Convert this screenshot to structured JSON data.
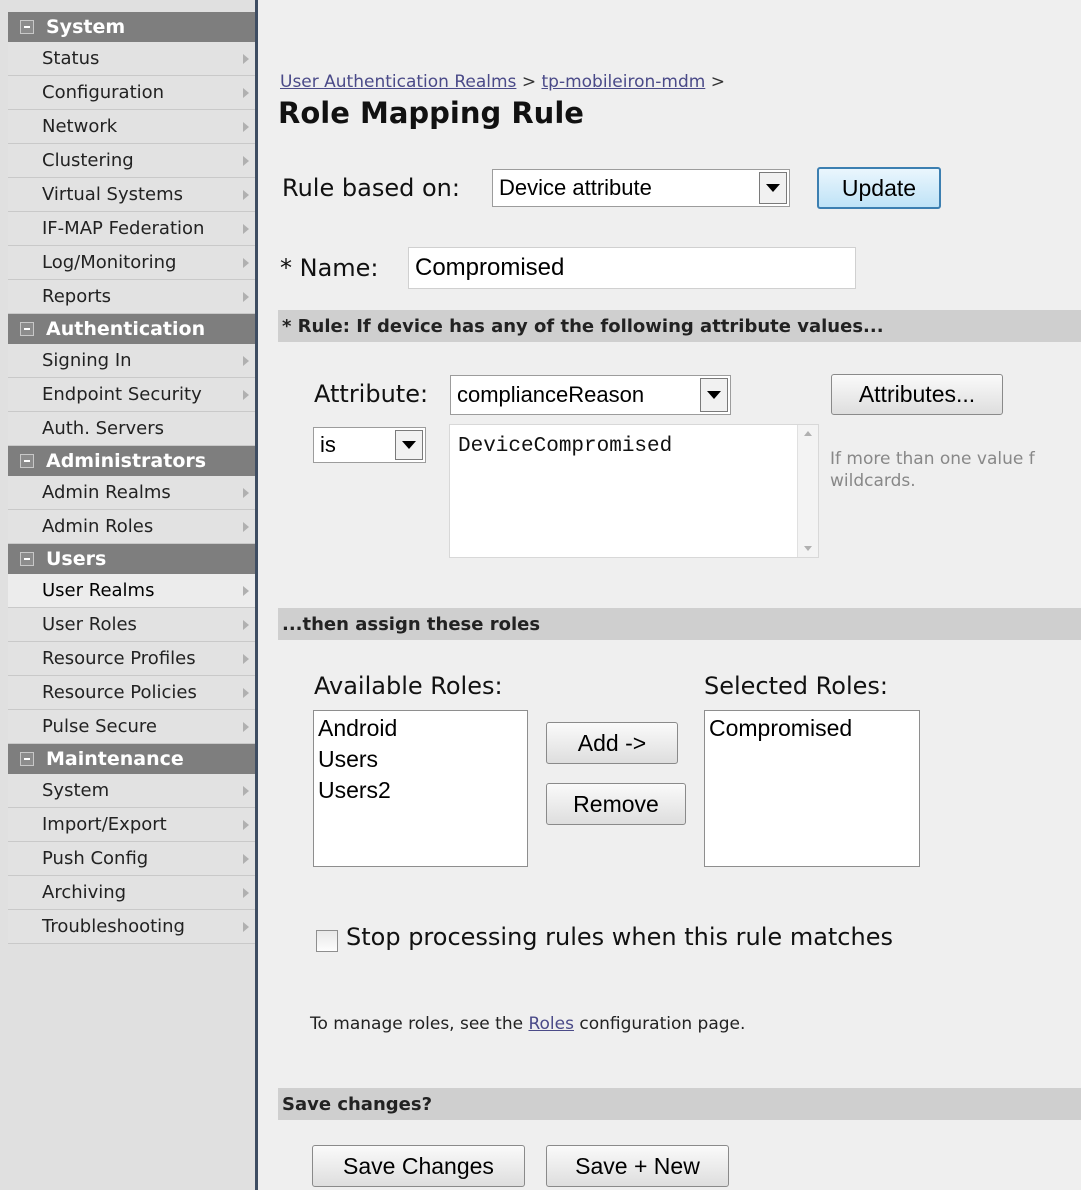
{
  "sidebar": {
    "sections": [
      {
        "title": "System",
        "items": [
          "Status",
          "Configuration",
          "Network",
          "Clustering",
          "Virtual Systems",
          "IF-MAP Federation",
          "Log/Monitoring",
          "Reports"
        ]
      },
      {
        "title": "Authentication",
        "items": [
          "Signing In",
          "Endpoint Security",
          "Auth. Servers"
        ]
      },
      {
        "title": "Administrators",
        "items": [
          "Admin Realms",
          "Admin Roles"
        ]
      },
      {
        "title": "Users",
        "items": [
          "User Realms",
          "User Roles",
          "Resource Profiles",
          "Resource Policies",
          "Pulse Secure"
        ]
      },
      {
        "title": "Maintenance",
        "items": [
          "System",
          "Import/Export",
          "Push Config",
          "Archiving",
          "Troubleshooting"
        ]
      }
    ]
  },
  "breadcrumb": {
    "link1": "User Authentication Realms",
    "sep1": " > ",
    "link2": "tp-mobileiron-mdm",
    "sep2": " >"
  },
  "page_title": "Role Mapping Rule",
  "rule_based": {
    "label": "Rule based on:",
    "value": "Device attribute",
    "update_label": "Update"
  },
  "name_field": {
    "label": "* Name:",
    "value": "Compromised"
  },
  "rule_bar": "* Rule: If device has any of the following attribute values...",
  "attribute": {
    "label": "Attribute:",
    "value": "complianceReason",
    "attributes_button": "Attributes..."
  },
  "operator": {
    "value": "is"
  },
  "values_text": "DeviceCompromised",
  "hint": {
    "line1": "If more than one value f",
    "line2": "wildcards."
  },
  "assign_bar": "...then assign these roles",
  "available_roles": {
    "label": "Available Roles:",
    "items": [
      "Android",
      "Users",
      "Users2"
    ]
  },
  "selected_roles": {
    "label": "Selected Roles:",
    "items": [
      "Compromised"
    ]
  },
  "add_label": "Add ->",
  "remove_label": "Remove",
  "stop_processing": {
    "label": "Stop processing rules when this rule matches",
    "checked": false
  },
  "manage": {
    "prefix": "To manage roles, see the ",
    "link": "Roles",
    "suffix": " configuration page."
  },
  "save_bar": "Save changes?",
  "save_changes_label": "Save Changes",
  "save_new_label": "Save + New"
}
